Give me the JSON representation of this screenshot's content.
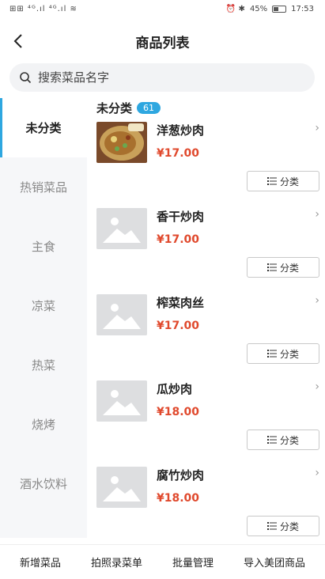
{
  "status_bar": {
    "left": "⊞⊞ ⁴ᴳ.ıl ⁴ᴳ.ıl ≋",
    "right_icons": "⏰ ✱",
    "battery_percent": "45%",
    "battery_level": 0.45,
    "time": "17:53"
  },
  "header": {
    "title": "商品列表"
  },
  "search": {
    "placeholder": "搜索菜品名字"
  },
  "sidebar": {
    "items": [
      {
        "label": "未分类",
        "active": true
      },
      {
        "label": "热销菜品",
        "active": false
      },
      {
        "label": "主食",
        "active": false
      },
      {
        "label": "凉菜",
        "active": false
      },
      {
        "label": "热菜",
        "active": false
      },
      {
        "label": "烧烤",
        "active": false
      },
      {
        "label": "酒水饮料",
        "active": false
      }
    ]
  },
  "category": {
    "title": "未分类",
    "count": "61"
  },
  "products": [
    {
      "name": "洋葱炒肉",
      "price": "¥17.00",
      "has_photo": true,
      "category_button": "分类"
    },
    {
      "name": "香干炒肉",
      "price": "¥17.00",
      "has_photo": false,
      "category_button": "分类"
    },
    {
      "name": "榨菜肉丝",
      "price": "¥17.00",
      "has_photo": false,
      "category_button": "分类"
    },
    {
      "name": "瓜炒肉",
      "price": "¥18.00",
      "has_photo": false,
      "category_button": "分类"
    },
    {
      "name": "腐竹炒肉",
      "price": "¥18.00",
      "has_photo": false,
      "category_button": "分类"
    }
  ],
  "bottom_bar": {
    "add_dish": "新增菜品",
    "photo_menu": "拍照录菜单",
    "batch_manage": "批量管理",
    "import_meituan": "导入美团商品"
  },
  "colors": {
    "accent": "#2ea7e0",
    "price": "#e0492d"
  }
}
